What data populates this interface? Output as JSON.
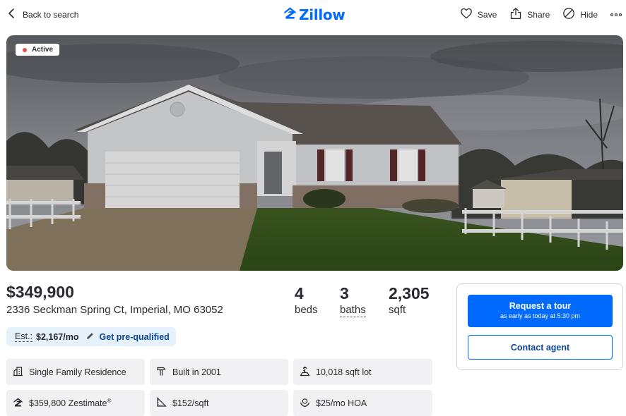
{
  "header": {
    "back_label": "Back to search",
    "brand": "Zillow",
    "brand_color": "#006aff",
    "actions": {
      "save": "Save",
      "share": "Share",
      "hide": "Hide"
    }
  },
  "photo": {
    "status": "Active",
    "status_color": "#e8504a"
  },
  "listing": {
    "price": "$349,900",
    "address": "2336 Seckman Spring Ct, Imperial, MO 63052",
    "beds_value": "4",
    "beds_label": "beds",
    "baths_value": "3",
    "baths_label": "baths",
    "sqft_value": "2,305",
    "sqft_label": "sqft"
  },
  "estimate": {
    "label": "Est.:",
    "value": "$2,167/mo",
    "prequalify": "Get pre-qualified"
  },
  "facts": {
    "type": "Single Family Residence",
    "built": "Built in 2001",
    "lot": "10,018 sqft lot",
    "zestimate": "$359,800 Zestimate",
    "zestimate_mark": "®",
    "price_per_sqft": "$152/sqft",
    "hoa": "$25/mo HOA"
  },
  "contact": {
    "tour_label": "Request a tour",
    "tour_sub": "as early as today at 5:30 pm",
    "contact_label": "Contact agent"
  },
  "icons": [
    "chevron-left-icon",
    "zillow-logo-icon",
    "heart-icon",
    "share-icon",
    "hide-icon",
    "more-icon",
    "pencil-icon",
    "building-icon",
    "hammer-icon",
    "lot-icon",
    "zestimate-icon",
    "ruler-icon",
    "hoa-icon"
  ]
}
